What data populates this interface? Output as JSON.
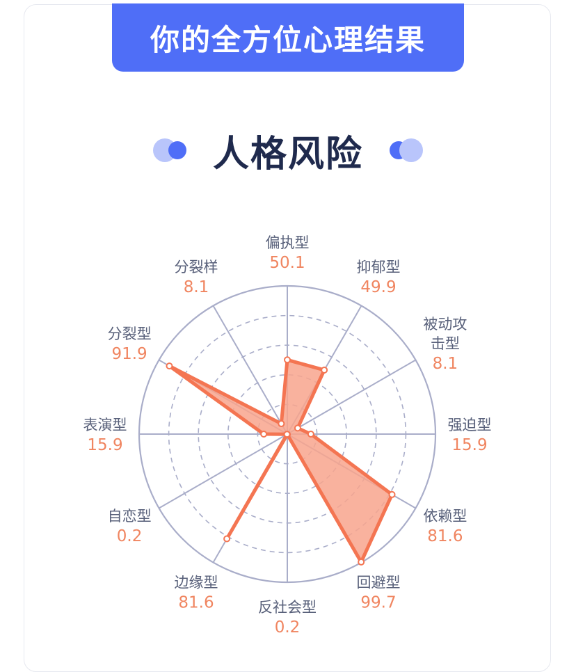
{
  "header": {
    "title": "你的全方位心理结果"
  },
  "section": {
    "title": "人格风险"
  },
  "colors": {
    "banner": "#4f6ef7",
    "title": "#1f2a4d",
    "axis": "#a9adc9",
    "label": "#58607a",
    "value": "#f08560",
    "area_fill": "#f8a58d",
    "area_stroke": "#f47552"
  },
  "chart_data": {
    "type": "radar",
    "rmax": 100,
    "rings": 5,
    "categories": [
      {
        "lines": [
          "偏执型"
        ],
        "value": 50.1,
        "value_label": "50.1"
      },
      {
        "lines": [
          "抑郁型"
        ],
        "value": 49.9,
        "value_label": "49.9"
      },
      {
        "lines": [
          "被动攻",
          "击型"
        ],
        "value": 8.1,
        "value_label": "8.1"
      },
      {
        "lines": [
          "强迫型"
        ],
        "value": 15.9,
        "value_label": "15.9"
      },
      {
        "lines": [
          "依赖型"
        ],
        "value": 81.6,
        "value_label": "81.6"
      },
      {
        "lines": [
          "回避型"
        ],
        "value": 99.7,
        "value_label": "99.7"
      },
      {
        "lines": [
          "反社会型"
        ],
        "value": 0.2,
        "value_label": "0.2"
      },
      {
        "lines": [
          "边缘型"
        ],
        "value": 81.6,
        "value_label": "81.6"
      },
      {
        "lines": [
          "自恋型"
        ],
        "value": 0.2,
        "value_label": "0.2"
      },
      {
        "lines": [
          "表演型"
        ],
        "value": 15.9,
        "value_label": "15.9"
      },
      {
        "lines": [
          "分裂型"
        ],
        "value": 91.9,
        "value_label": "91.9"
      },
      {
        "lines": [
          "分裂样"
        ],
        "value": 8.1,
        "value_label": "8.1"
      }
    ]
  }
}
